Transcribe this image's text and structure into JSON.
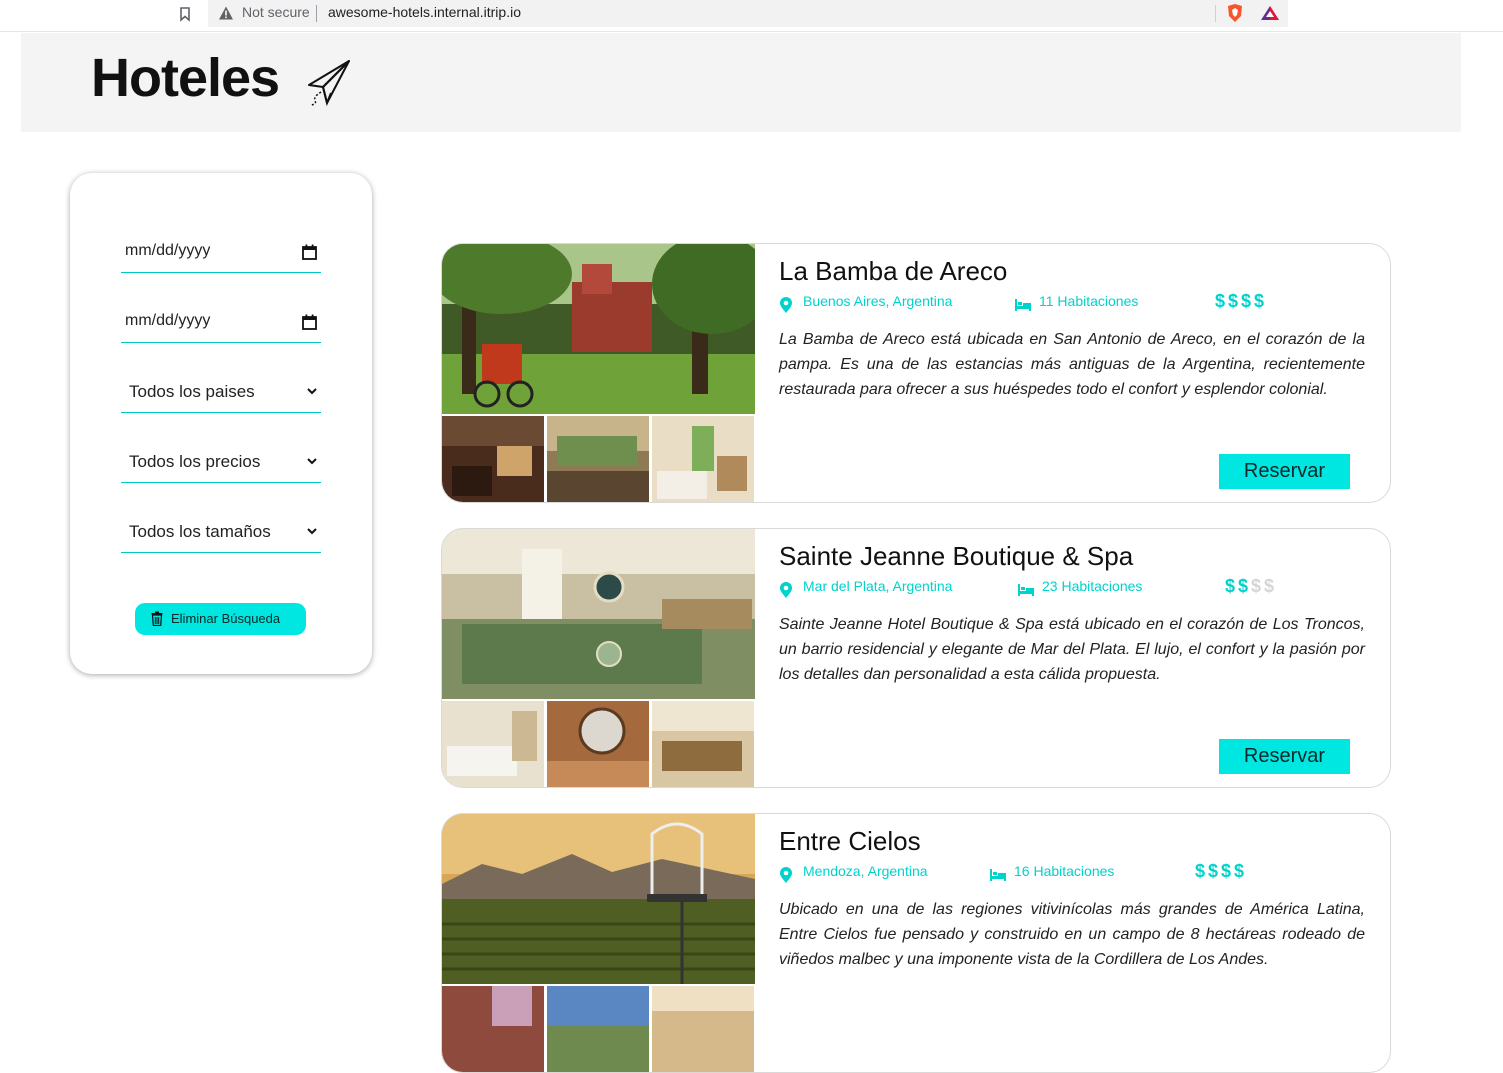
{
  "browser": {
    "security_label": "Not secure",
    "url": "awesome-hotels.internal.itrip.io"
  },
  "header": {
    "title": "Hoteles",
    "logo_icon": "paper-plane-icon"
  },
  "filters": {
    "date_from_placeholder": "mm/dd/yyyy",
    "date_to_placeholder": "mm/dd/yyyy",
    "country_select": "Todos los paises",
    "price_select": "Todos los precios",
    "size_select": "Todos los tamaños",
    "clear_button": "Eliminar Búsqueda",
    "accent_color": "#00e6e0"
  },
  "hotels": [
    {
      "name": "La Bamba de Areco",
      "location": "Buenos Aires, Argentina",
      "rooms": "11 Habitaciones",
      "price_level": 4,
      "price_max": 4,
      "description": "La Bamba de Areco está ubicada en San Antonio de Areco, en el corazón de la pampa. Es una de las estancias más antiguas de la Argentina, recientemente restaurada para ofrecer a sus huéspedes todo el confort y esplendor colonial.",
      "button": "Reservar"
    },
    {
      "name": "Sainte Jeanne Boutique & Spa",
      "location": "Mar del Plata, Argentina",
      "rooms": "23 Habitaciones",
      "price_level": 2,
      "price_max": 4,
      "description": "Sainte Jeanne Hotel Boutique & Spa está ubicado en el corazón de Los Troncos, un barrio residencial y elegante de Mar del Plata. El lujo, el confort y la pasión por los detalles dan personalidad a esta cálida propuesta.",
      "button": "Reservar"
    },
    {
      "name": "Entre Cielos",
      "location": "Mendoza, Argentina",
      "rooms": "16 Habitaciones",
      "price_level": 4,
      "price_max": 4,
      "description": "Ubicado en una de las regiones vitivinícolas más grandes de América Latina, Entre Cielos fue pensado y construido en un campo de 8 hectáreas rodeado de viñedos malbec y una imponente vista de la Cordillera de Los Andes.",
      "button": "Reservar"
    }
  ]
}
